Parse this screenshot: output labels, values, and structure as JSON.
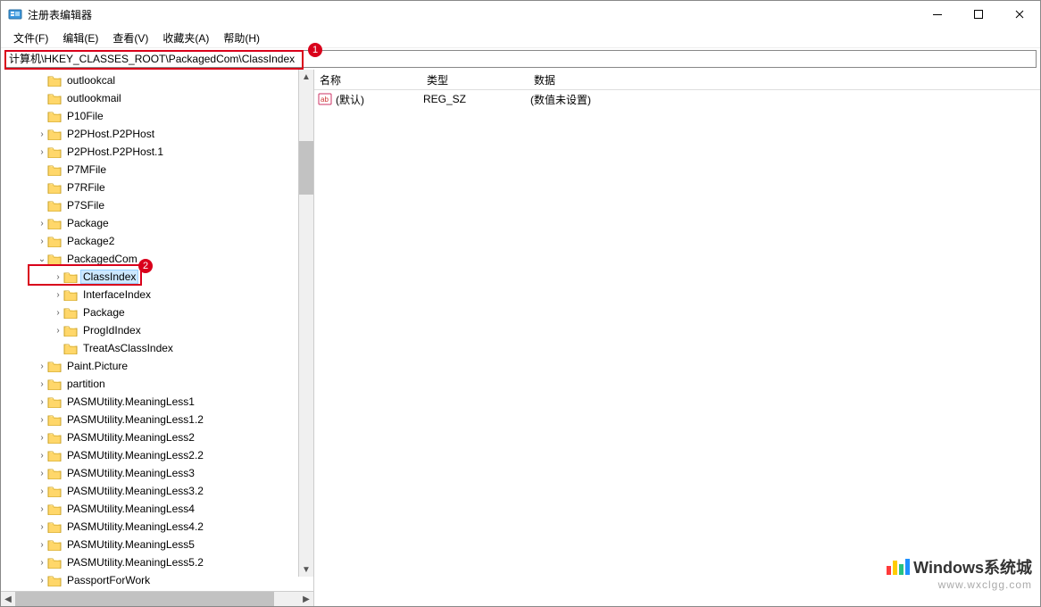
{
  "titlebar": {
    "title": "注册表编辑器"
  },
  "menu": {
    "file": "文件(F)",
    "edit": "编辑(E)",
    "view": "查看(V)",
    "favorites": "收藏夹(A)",
    "help": "帮助(H)"
  },
  "address": {
    "path": "计算机\\HKEY_CLASSES_ROOT\\PackagedCom\\ClassIndex"
  },
  "annotations": {
    "badge1": "1",
    "badge2": "2"
  },
  "tree": {
    "items": [
      {
        "level": 1,
        "expander": "",
        "label": "outlookcal"
      },
      {
        "level": 1,
        "expander": "",
        "label": "outlookmail"
      },
      {
        "level": 1,
        "expander": "",
        "label": "P10File"
      },
      {
        "level": 1,
        "expander": ">",
        "label": "P2PHost.P2PHost"
      },
      {
        "level": 1,
        "expander": ">",
        "label": "P2PHost.P2PHost.1"
      },
      {
        "level": 1,
        "expander": "",
        "label": "P7MFile"
      },
      {
        "level": 1,
        "expander": "",
        "label": "P7RFile"
      },
      {
        "level": 1,
        "expander": "",
        "label": "P7SFile"
      },
      {
        "level": 1,
        "expander": ">",
        "label": "Package"
      },
      {
        "level": 1,
        "expander": ">",
        "label": "Package2"
      },
      {
        "level": 1,
        "expander": "v",
        "label": "PackagedCom"
      },
      {
        "level": 2,
        "expander": ">",
        "label": "ClassIndex",
        "selected": true,
        "highlight": true
      },
      {
        "level": 2,
        "expander": ">",
        "label": "InterfaceIndex"
      },
      {
        "level": 2,
        "expander": ">",
        "label": "Package"
      },
      {
        "level": 2,
        "expander": ">",
        "label": "ProgIdIndex"
      },
      {
        "level": 2,
        "expander": "",
        "label": "TreatAsClassIndex"
      },
      {
        "level": 1,
        "expander": ">",
        "label": "Paint.Picture"
      },
      {
        "level": 1,
        "expander": ">",
        "label": "partition"
      },
      {
        "level": 1,
        "expander": ">",
        "label": "PASMUtility.MeaningLess1"
      },
      {
        "level": 1,
        "expander": ">",
        "label": "PASMUtility.MeaningLess1.2"
      },
      {
        "level": 1,
        "expander": ">",
        "label": "PASMUtility.MeaningLess2"
      },
      {
        "level": 1,
        "expander": ">",
        "label": "PASMUtility.MeaningLess2.2"
      },
      {
        "level": 1,
        "expander": ">",
        "label": "PASMUtility.MeaningLess3"
      },
      {
        "level": 1,
        "expander": ">",
        "label": "PASMUtility.MeaningLess3.2"
      },
      {
        "level": 1,
        "expander": ">",
        "label": "PASMUtility.MeaningLess4"
      },
      {
        "level": 1,
        "expander": ">",
        "label": "PASMUtility.MeaningLess4.2"
      },
      {
        "level": 1,
        "expander": ">",
        "label": "PASMUtility.MeaningLess5"
      },
      {
        "level": 1,
        "expander": ">",
        "label": "PASMUtility.MeaningLess5.2"
      },
      {
        "level": 1,
        "expander": ">",
        "label": "PassportForWork"
      }
    ]
  },
  "values": {
    "headers": {
      "name": "名称",
      "type": "类型",
      "data": "数据"
    },
    "rows": [
      {
        "name": "(默认)",
        "type": "REG_SZ",
        "data": "(数值未设置)"
      }
    ]
  },
  "watermark": {
    "line1": "Windows系统城",
    "line2": "www.wxclgg.com"
  },
  "colors": {
    "wm1": "#ff3a3a",
    "wm2": "#ffcc00",
    "wm3": "#26c281",
    "wm4": "#1e90ff"
  }
}
